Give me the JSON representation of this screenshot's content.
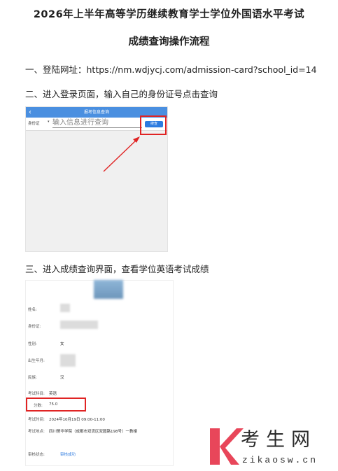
{
  "doc": {
    "title_line1": "2026年上半年高等学历继续教育学士学位外国语水平考试",
    "title_line2": "成绩查询操作流程",
    "step1": "一、登陆网址：https://nm.wdjycj.com/admission-card?school_id=14",
    "step2": "二、进入登录页面，输入自己的身份证号点击查询",
    "step3": "三、进入成绩查询界面，查看学位英语考试成绩"
  },
  "query_page": {
    "back": "‹",
    "title": "报考信息查询",
    "id_type": "身份证",
    "caret": "▾",
    "input_placeholder": "输入信息进行查询",
    "query_button": "搜查"
  },
  "result_page": {
    "name_label": "姓名:",
    "id_label": "身份证:",
    "gender_label": "性别:",
    "gender_value": "女",
    "birth_label": "出生年月:",
    "ethnic_label": "民族:",
    "ethnic_value": "汉",
    "subject_label": "考试科目:",
    "subject_value": "英语",
    "score_label": "分数:",
    "score_value": "75.0",
    "time_label": "考试时间:",
    "time_value": "2024年10月19日 09:00-11:00",
    "location_label": "考试地点:",
    "location_value": "四川警华学院（成都市双流区双圆路198号）一教楼",
    "status_label": "审核状态:",
    "status_value": "审核成功"
  },
  "watermark": {
    "brand": "考生网",
    "domain": "zikaosw.cn"
  },
  "colors": {
    "highlight": "#e02424",
    "topbar": "#4a8fe0",
    "button": "#2d7be0",
    "watermark_k": "#e8465a"
  }
}
